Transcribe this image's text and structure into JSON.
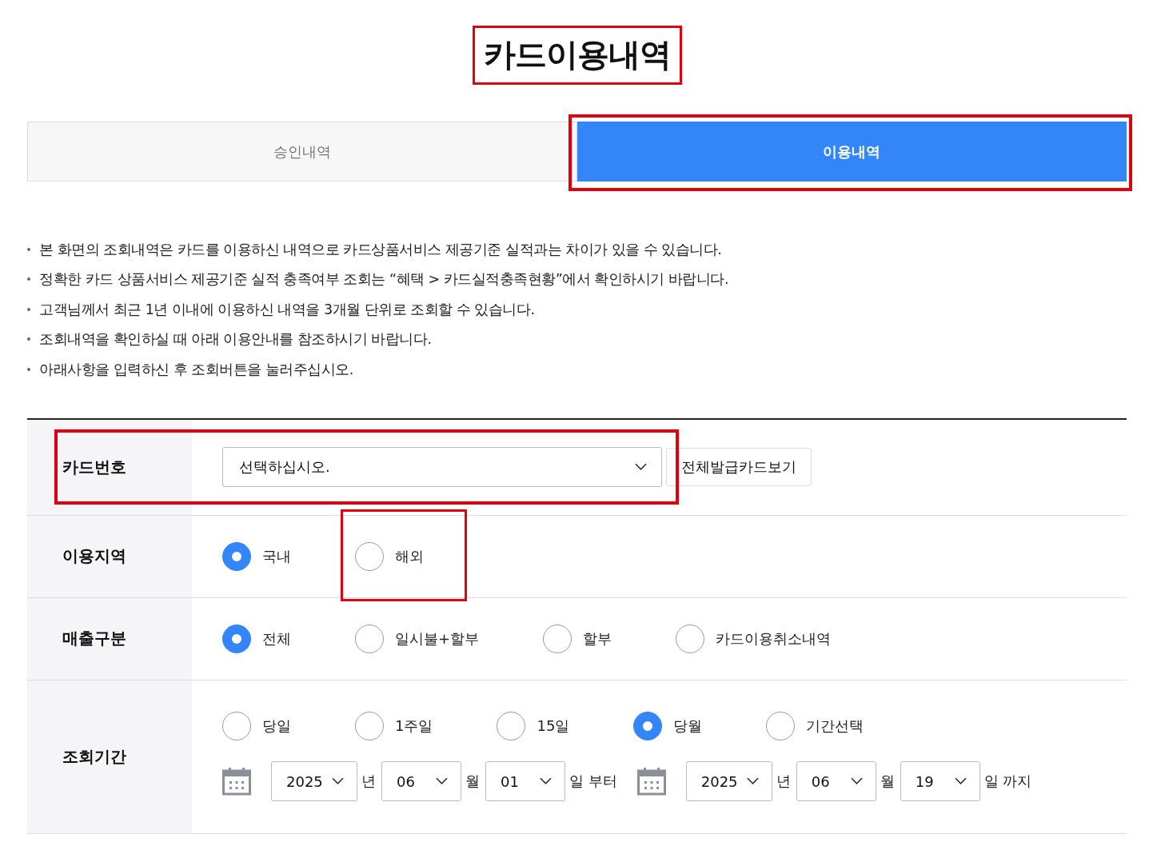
{
  "title": {
    "text": "카드이용내역",
    "highlighted": true
  },
  "tabs": [
    {
      "label": "승인내역",
      "selected": false,
      "highlighted": false
    },
    {
      "label": "이용내역",
      "selected": true,
      "highlighted": true
    }
  ],
  "notes": [
    "본 화면의 조회내역은 카드를 이용하신 내역으로 카드상품서비스 제공기준 실적과는 차이가 있을 수 있습니다.",
    "정확한 카드 상품서비스 제공기준 실적 충족여부 조회는 “혜택 > 카드실적충족현황”에서 확인하시기 바랍니다.",
    "고객님께서 최근 1년 이내에 이용하신 내역을 3개월 단위로 조회할 수 있습니다.",
    "조회내역을 확인하실 때 아래 이용안내를 참조하시기 바랍니다.",
    "아래사항을 입력하신 후 조회버튼을 눌러주십시오."
  ],
  "form": {
    "rows": [
      {
        "kind": "card",
        "label": "카드번호",
        "highlighted": true,
        "select": "선택하십시오.",
        "button": "전체발급카드보기"
      },
      {
        "kind": "radios",
        "label": "이용지역",
        "options": [
          {
            "label": "국내",
            "selected": true,
            "highlighted": false
          },
          {
            "label": "해외",
            "selected": false,
            "highlighted": true
          }
        ]
      },
      {
        "kind": "radios",
        "label": "매출구분",
        "options": [
          {
            "label": "전체",
            "selected": true,
            "highlighted": false
          },
          {
            "label": "일시불+할부",
            "selected": false,
            "highlighted": false
          },
          {
            "label": "할부",
            "selected": false,
            "highlighted": false
          },
          {
            "label": "카드이용취소내역",
            "selected": false,
            "highlighted": false
          }
        ]
      },
      {
        "kind": "period",
        "label": "조회기간",
        "options": [
          {
            "label": "당일",
            "selected": false,
            "highlighted": false
          },
          {
            "label": "1주일",
            "selected": false,
            "highlighted": false
          },
          {
            "label": "15일",
            "selected": false,
            "highlighted": false
          },
          {
            "label": "당월",
            "selected": true,
            "highlighted": false
          },
          {
            "label": "기간선택",
            "selected": false,
            "highlighted": false
          }
        ],
        "range": [
          {
            "year": "2025",
            "year_unit": "년",
            "month": "06",
            "month_unit": "월",
            "day": "01",
            "day_unit": "일 부터"
          },
          {
            "year": "2025",
            "year_unit": "년",
            "month": "06",
            "month_unit": "월",
            "day": "19",
            "day_unit": "일 까지"
          }
        ]
      }
    ]
  }
}
